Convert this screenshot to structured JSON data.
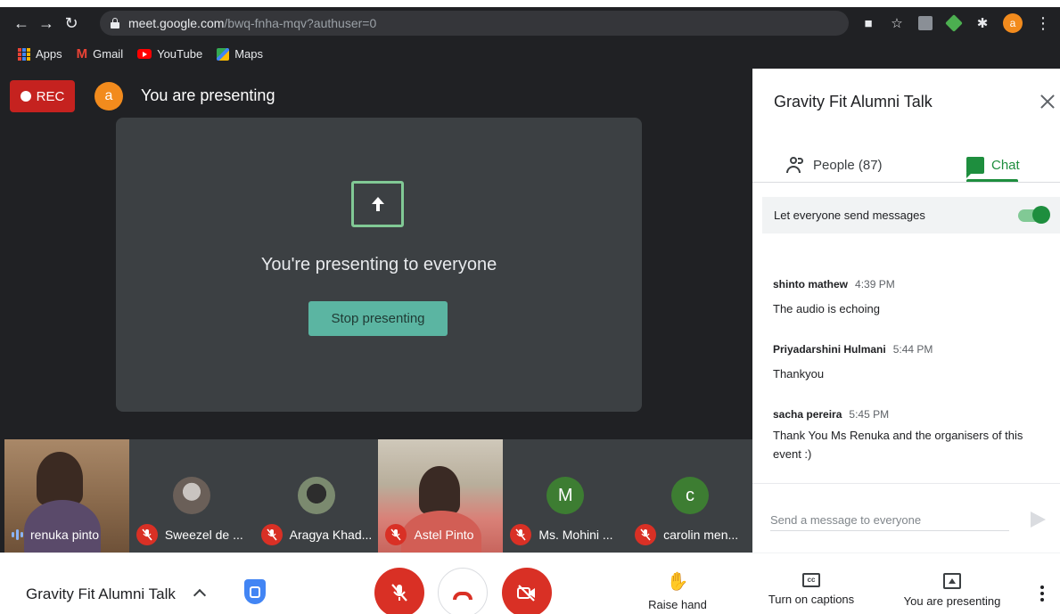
{
  "browser": {
    "url_host": "meet.google.com",
    "url_path": "/bwq-fnha-mqv?authuser=0",
    "profile_initial": "a",
    "bookmarks": [
      {
        "label": "Apps",
        "icon": "apps-grid-icon"
      },
      {
        "label": "Gmail",
        "icon": "gmail-icon"
      },
      {
        "label": "YouTube",
        "icon": "youtube-icon"
      },
      {
        "label": "Maps",
        "icon": "maps-icon"
      }
    ]
  },
  "stage": {
    "rec_label": "REC",
    "presenter_initial": "a",
    "presenting_label": "You are presenting",
    "present_card_title": "You're presenting to everyone",
    "stop_button": "Stop presenting"
  },
  "participants": [
    {
      "name": "renuka pinto",
      "muted": false,
      "speaking": true
    },
    {
      "name": "Sweezel de ...",
      "muted": true
    },
    {
      "name": "Aragya Khad...",
      "muted": true
    },
    {
      "name": "Astel Pinto",
      "muted": true
    },
    {
      "name": "Ms. Mohini ...",
      "muted": true,
      "initial": "M"
    },
    {
      "name": "carolin men...",
      "muted": true,
      "initial": "c"
    }
  ],
  "panel": {
    "title": "Gravity Fit Alumni Talk",
    "tab_people": "People (87)",
    "tab_chat": "Chat",
    "permission_label": "Let everyone send messages",
    "permission_on": true,
    "messages": [
      {
        "sender": "shinto mathew",
        "time": "4:39 PM",
        "text": "The audio is echoing"
      },
      {
        "sender": "Priyadarshini Hulmani",
        "time": "5:44 PM",
        "text": "Thankyou"
      },
      {
        "sender": "sacha pereira",
        "time": "5:45 PM",
        "text": "Thank You Ms Renuka and the organisers of this event :)"
      }
    ],
    "compose_placeholder": "Send a message to everyone"
  },
  "bottombar": {
    "meeting_name": "Gravity Fit Alumni Talk",
    "raise_hand": "Raise hand",
    "captions": "Turn on captions",
    "presenting": "You are presenting"
  },
  "colors": {
    "accent_green": "#1e8e3e",
    "danger_red": "#d93025",
    "stage_dark": "#202124",
    "stop_button": "#5bb5a2"
  }
}
